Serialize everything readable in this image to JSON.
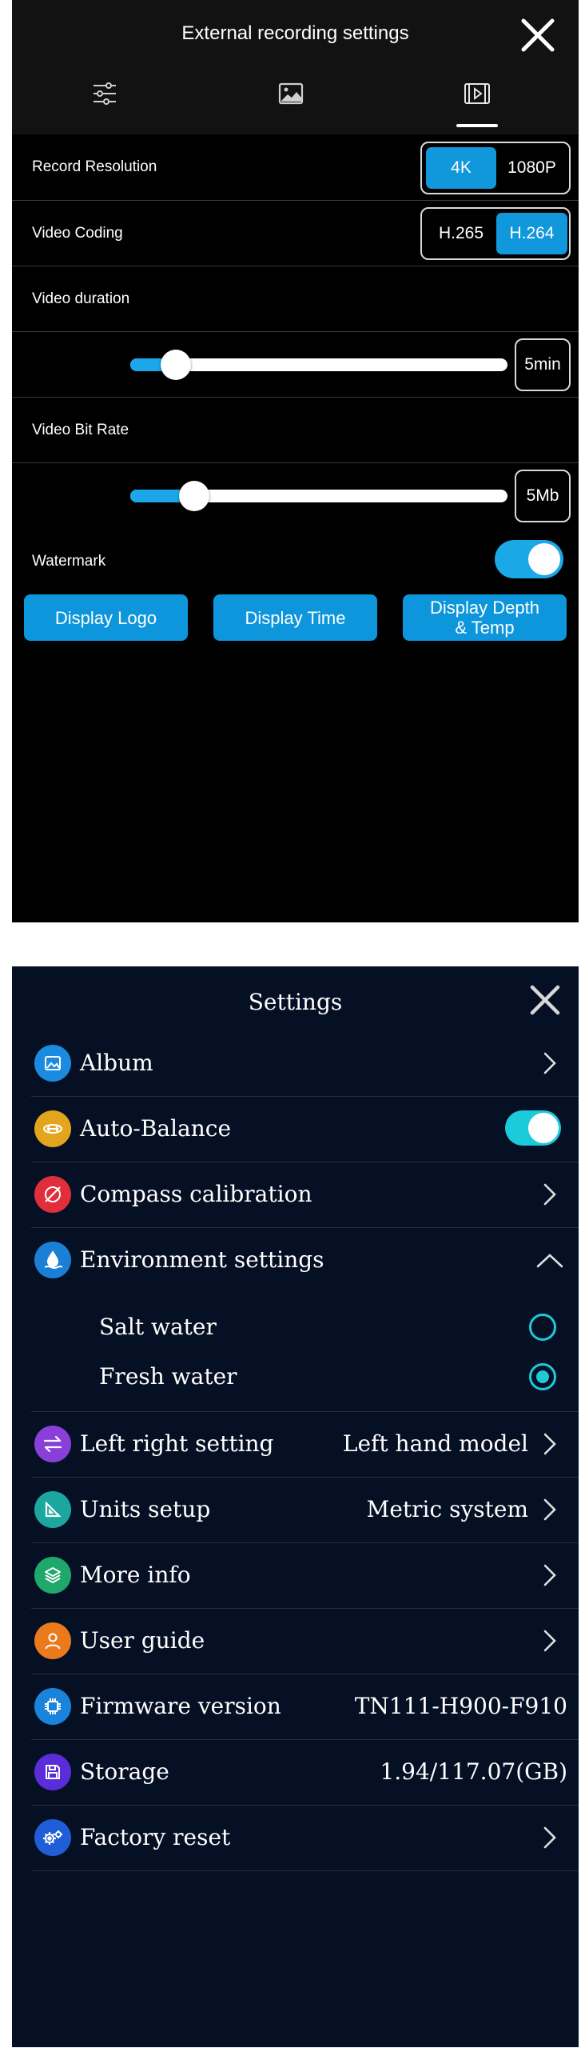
{
  "recording": {
    "title": "External recording settings",
    "tabs": [
      {
        "icon": "sliders-icon"
      },
      {
        "icon": "image-icon"
      },
      {
        "icon": "video-icon",
        "active": true
      }
    ],
    "resolution": {
      "label": "Record Resolution",
      "options": [
        "4K",
        "1080P"
      ],
      "selected": "4K"
    },
    "coding": {
      "label": "Video Coding",
      "options": [
        "H.265",
        "H.264"
      ],
      "selected": "H.264"
    },
    "duration": {
      "label": "Video duration",
      "value": "5min",
      "level": 0.12
    },
    "bitrate": {
      "label": "Video Bit Rate",
      "value": "5Mb",
      "level": 0.17
    },
    "watermark": {
      "label": "Watermark",
      "enabled": true,
      "buttons": [
        "Display Logo",
        "Display Time",
        "Display Depth\n& Temp"
      ]
    },
    "colors": {
      "accent": "#1097dc",
      "background": "#000000"
    }
  },
  "settings": {
    "title": "Settings",
    "items": [
      {
        "label": "Album",
        "icon": "album-icon",
        "icon_color": "#1a8be0",
        "control": "chevron"
      },
      {
        "label": "Auto-Balance",
        "icon": "auto-balance-icon",
        "icon_color": "#e3a51d",
        "control": "toggle",
        "enabled": true
      },
      {
        "label": "Compass calibration",
        "icon": "compass-icon",
        "icon_color": "#e02f3a",
        "control": "chevron"
      },
      {
        "label": "Environment settings",
        "icon": "water-drop-icon",
        "icon_color": "#1b7fd6",
        "control": "chevron-up",
        "options": [
          {
            "label": "Salt water",
            "selected": false
          },
          {
            "label": "Fresh water",
            "selected": true
          }
        ]
      },
      {
        "label": "Left right setting",
        "icon": "swap-arrows-icon",
        "icon_color": "#8b3fd9",
        "value": "Left hand model",
        "control": "chevron"
      },
      {
        "label": "Units setup",
        "icon": "ruler-triangle-icon",
        "icon_color": "#1ba79e",
        "value": "Metric system",
        "control": "chevron"
      },
      {
        "label": "More info",
        "icon": "layers-icon",
        "icon_color": "#1fa86b",
        "control": "chevron"
      },
      {
        "label": "User guide",
        "icon": "user-icon",
        "icon_color": "#ea7a1c",
        "control": "chevron"
      },
      {
        "label": "Firmware version",
        "icon": "chip-icon",
        "icon_color": "#1a84dc",
        "value": "TN111-H900-F910",
        "control": "none"
      },
      {
        "label": "Storage",
        "icon": "floppy-disk-icon",
        "icon_color": "#5b2dd8",
        "value": "1.94/117.07(GB)",
        "control": "none"
      },
      {
        "label": "Factory reset",
        "icon": "gears-icon",
        "icon_color": "#1f5ed8",
        "control": "chevron"
      }
    ],
    "colors": {
      "accent": "#1bcbdc",
      "background": "#061024"
    }
  }
}
